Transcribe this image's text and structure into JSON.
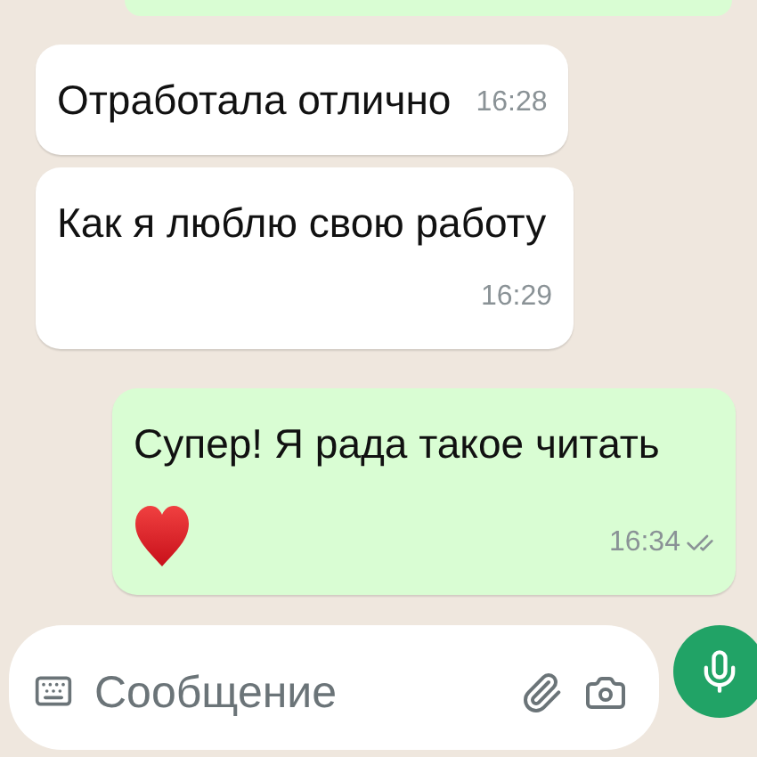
{
  "messages": [
    {
      "kind": "incoming",
      "text": "Отработала отлично",
      "time": "16:28"
    },
    {
      "kind": "incoming",
      "text": "Как я люблю свою работу",
      "time": "16:29"
    },
    {
      "kind": "outgoing",
      "text": "Супер! Я рада такое читать",
      "time": "16:34",
      "read": false,
      "stickers": [
        {
          "kind": "heart"
        }
      ]
    }
  ],
  "composer": {
    "placeholder": "Сообщение"
  }
}
